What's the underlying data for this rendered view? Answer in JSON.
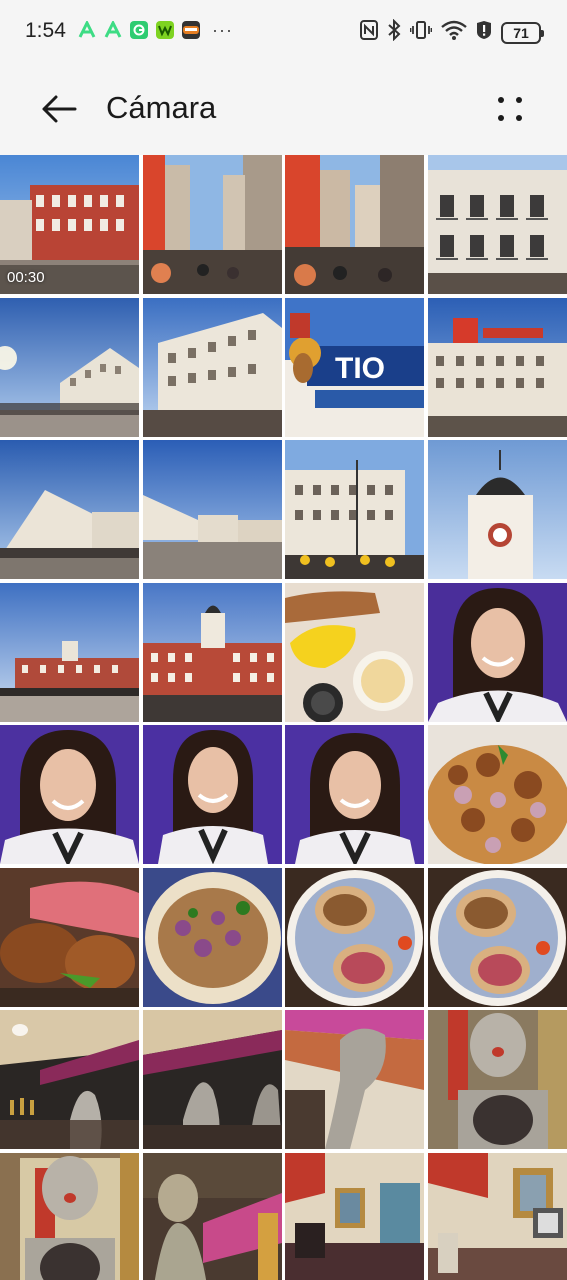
{
  "status_bar": {
    "time": "1:54",
    "more_indicator": "···",
    "battery": "71",
    "app_icons": [
      "app-a-green",
      "app-a-green",
      "app-g-green",
      "app-w-green",
      "app-photo"
    ]
  },
  "header": {
    "title": "Cámara",
    "back_icon": "arrow-left-icon",
    "more_icon": "more-options-icon"
  },
  "gallery": {
    "items": [
      {
        "scene": "building-red",
        "duration": "00:30"
      },
      {
        "scene": "street-crowd"
      },
      {
        "scene": "street-crowd-2"
      },
      {
        "scene": "facade-white"
      },
      {
        "scene": "plaza-sky"
      },
      {
        "scene": "white-building"
      },
      {
        "scene": "tio-pepe-sign",
        "sign_text": "TIO"
      },
      {
        "scene": "tio-pepe-building"
      },
      {
        "scene": "plaza-wide"
      },
      {
        "scene": "plaza-wide-2"
      },
      {
        "scene": "plaza-building"
      },
      {
        "scene": "clock-tower"
      },
      {
        "scene": "plaza-sunny"
      },
      {
        "scene": "government-building"
      },
      {
        "scene": "food-plate"
      },
      {
        "scene": "portrait-purple"
      },
      {
        "scene": "portrait-purple"
      },
      {
        "scene": "portrait-purple"
      },
      {
        "scene": "portrait-purple"
      },
      {
        "scene": "taco-closeup"
      },
      {
        "scene": "meat-closeup"
      },
      {
        "scene": "taco-plate"
      },
      {
        "scene": "tacos-blue-plate"
      },
      {
        "scene": "tacos-blue-plate"
      },
      {
        "scene": "bar-interior"
      },
      {
        "scene": "bar-interior-2"
      },
      {
        "scene": "sculpture-closeup"
      },
      {
        "scene": "sculpture-head"
      },
      {
        "scene": "sculpture-head-2"
      },
      {
        "scene": "statue-bar"
      },
      {
        "scene": "restaurant-room"
      },
      {
        "scene": "restaurant-room-2"
      }
    ]
  }
}
